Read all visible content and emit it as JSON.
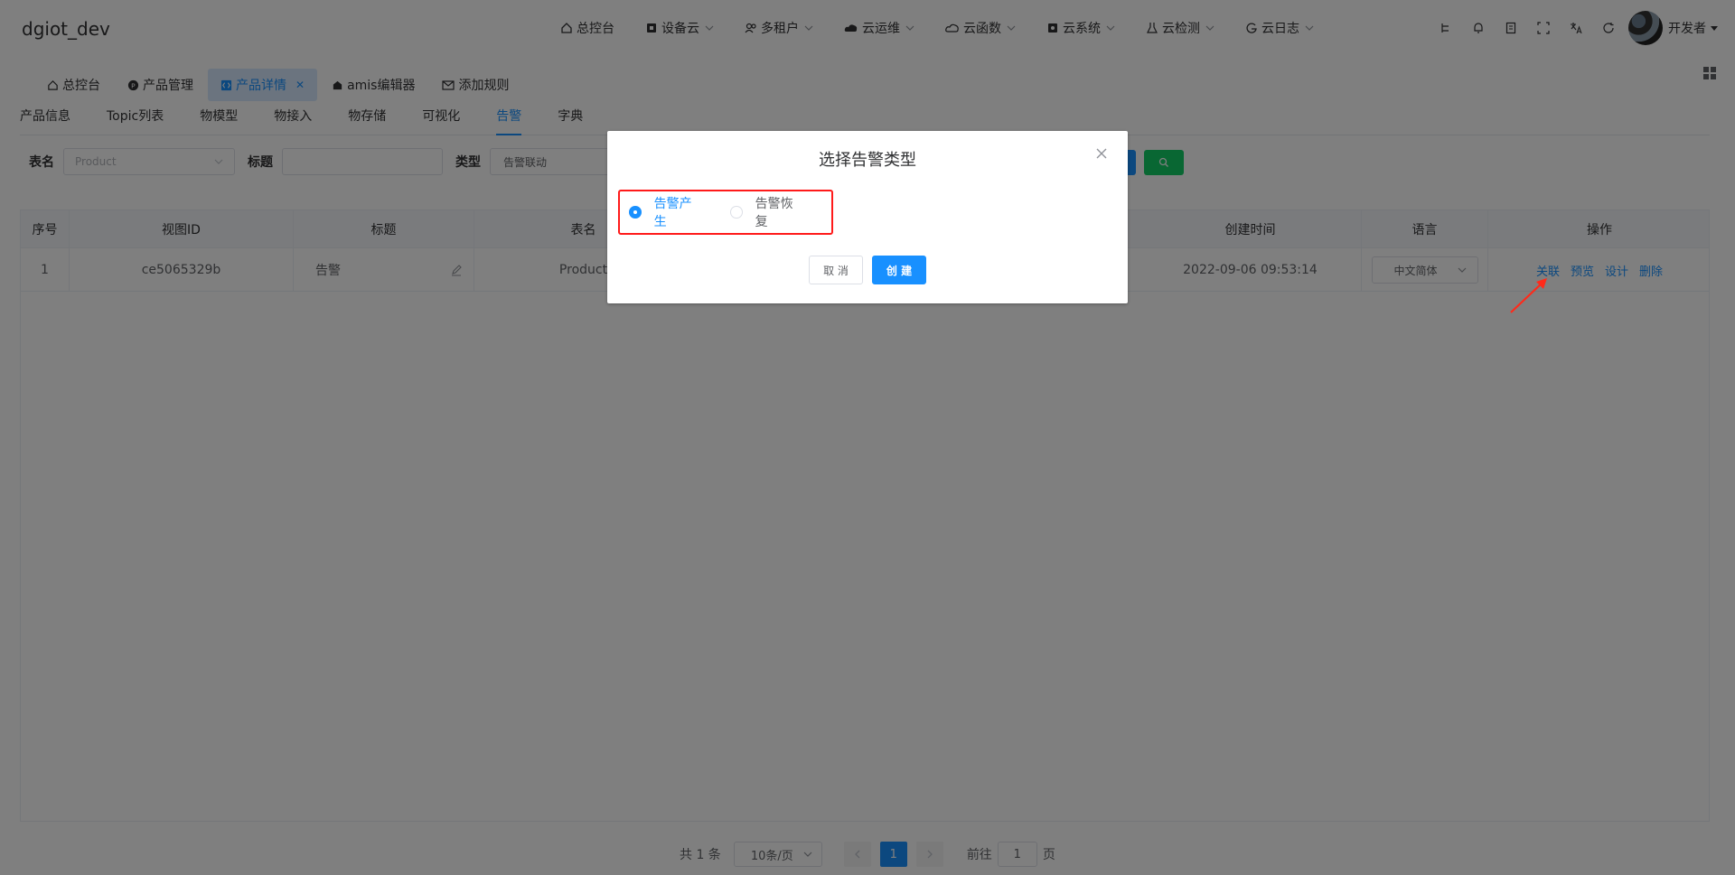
{
  "header": {
    "logo": "dgiot_dev",
    "nav": [
      {
        "label": "总控台",
        "icon": "home-icon",
        "dropdown": false
      },
      {
        "label": "设备云",
        "icon": "device-cloud-icon",
        "dropdown": true
      },
      {
        "label": "多租户",
        "icon": "users-icon",
        "dropdown": true
      },
      {
        "label": "云运维",
        "icon": "cloud-ops-icon",
        "dropdown": true
      },
      {
        "label": "云函数",
        "icon": "cloud-function-icon",
        "dropdown": true
      },
      {
        "label": "云系统",
        "icon": "cloud-system-icon",
        "dropdown": true
      },
      {
        "label": "云检测",
        "icon": "cloud-test-icon",
        "dropdown": true
      },
      {
        "label": "云日志",
        "icon": "cloud-log-icon",
        "dropdown": true
      }
    ],
    "user": "开发者"
  },
  "tags": [
    {
      "label": "总控台",
      "icon": "home-icon"
    },
    {
      "label": "产品管理",
      "icon": "product-icon"
    },
    {
      "label": "产品详情",
      "icon": "code-icon",
      "active": true
    },
    {
      "label": "amis编辑器",
      "icon": "editor-icon"
    },
    {
      "label": "添加规则",
      "icon": "mail-icon"
    }
  ],
  "subtabs": [
    "产品信息",
    "Topic列表",
    "物模型",
    "物接入",
    "物存储",
    "可视化",
    "告警",
    "字典"
  ],
  "active_subtab": "告警",
  "filter": {
    "table_label": "表名",
    "table_placeholder": "Product",
    "title_label": "标题",
    "type_label": "类型",
    "type_value": "告警联动"
  },
  "table": {
    "headers": [
      "序号",
      "视图ID",
      "标题",
      "表名",
      "创建时间",
      "语言",
      "操作"
    ],
    "rows": [
      {
        "index": "1",
        "view_id": "ce5065329b",
        "title": "告警",
        "table_name": "Product",
        "created_at": "2022-09-06 09:53:14",
        "language": "中文简体",
        "actions": [
          "关联",
          "预览",
          "设计",
          "删除"
        ]
      }
    ]
  },
  "pagination": {
    "total": "共 1 条",
    "page_size": "10条/页",
    "current": "1",
    "goto_prefix": "前往",
    "goto_value": "1",
    "goto_suffix": "页"
  },
  "dialog": {
    "title": "选择告警类型",
    "options": [
      "告警产生",
      "告警恢复"
    ],
    "selected": "告警产生",
    "cancel": "取 消",
    "create": "创 建"
  },
  "colors": {
    "primary": "#1890ff",
    "success": "#13ce66",
    "highlight_border": "#ff1a1a",
    "annotation_arrow": "#ff2a1a"
  }
}
